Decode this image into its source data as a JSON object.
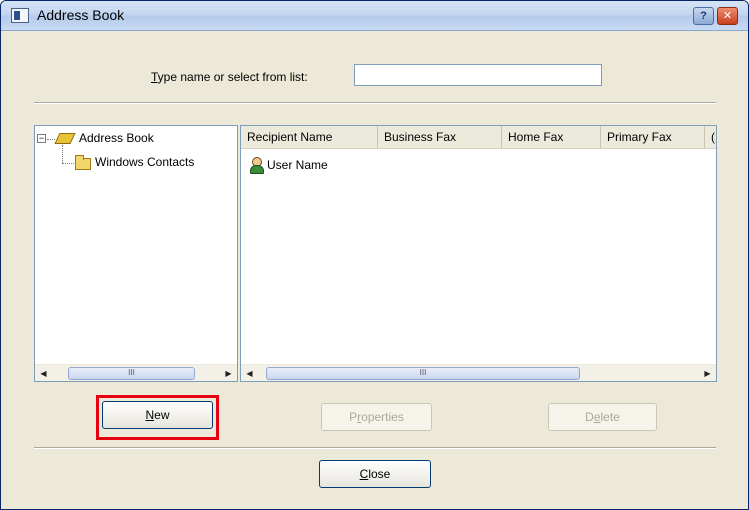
{
  "window": {
    "title": "Address Book",
    "help_glyph": "?",
    "close_glyph": "✕"
  },
  "search": {
    "label_accel": "T",
    "label_rest": "ype name or select from list:",
    "value": ""
  },
  "tree": {
    "expander_glyph": "−",
    "root_label": "Address Book",
    "child_label": "Windows Contacts"
  },
  "list": {
    "columns": [
      "Recipient Name",
      "Business Fax",
      "Home Fax",
      "Primary Fax",
      "("
    ],
    "items": [
      {
        "name": "User Name"
      }
    ]
  },
  "scrollbars": {
    "left_arrow": "◀",
    "right_arrow": "▶",
    "thumb_grip": "III"
  },
  "buttons": {
    "new_accel": "N",
    "new_rest": "ew",
    "properties_pre": "P",
    "properties_accel": "r",
    "properties_rest": "operties",
    "delete_pre": "D",
    "delete_accel": "e",
    "delete_rest": "lete",
    "close_accel": "C",
    "close_rest": "lose"
  },
  "colors": {
    "highlight": "#e60012",
    "title_bar": "#c3d6f0"
  }
}
